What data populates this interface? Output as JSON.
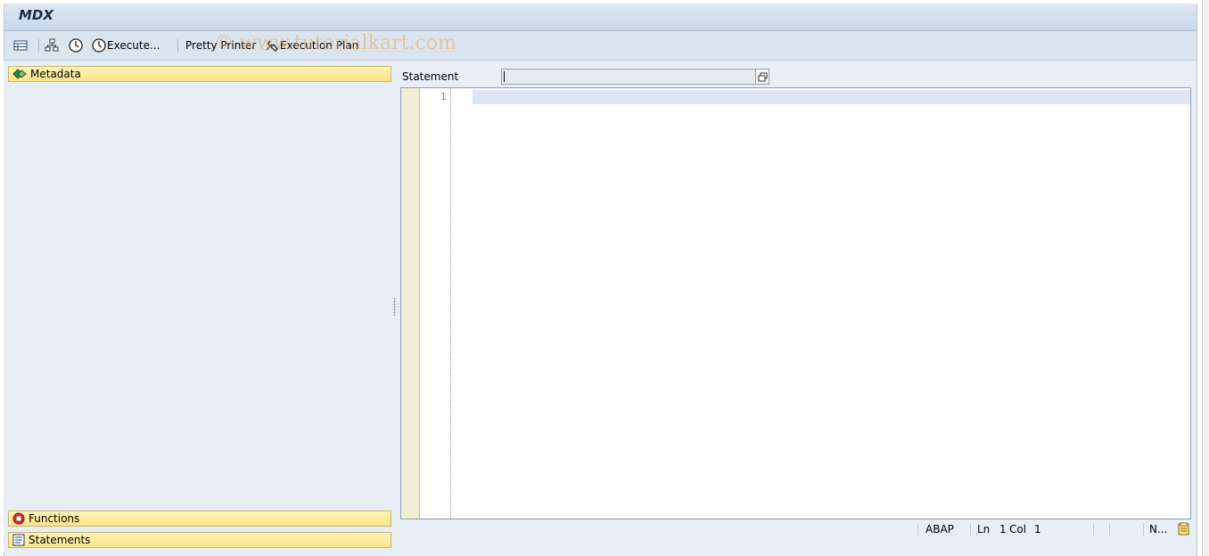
{
  "window": {
    "title": "MDX"
  },
  "toolbar": {
    "execute_label": "Execute...",
    "pretty_printer_label": "Pretty Printer",
    "execution_plan_label": "Execution Plan"
  },
  "watermark": "© www.tutorialkart.com",
  "left_panel": {
    "metadata_label": "Metadata",
    "functions_label": "Functions",
    "statements_label": "Statements"
  },
  "statement": {
    "label": "Statement",
    "value": ""
  },
  "editor": {
    "line_number": "1"
  },
  "status": {
    "language": "ABAP",
    "ln_label": "Ln",
    "ln_value": "1",
    "col_label": "Col",
    "col_value": "1",
    "mode": "N..."
  },
  "colors": {
    "panel_header": "#ffe48a",
    "accent": "#1d2c44"
  }
}
